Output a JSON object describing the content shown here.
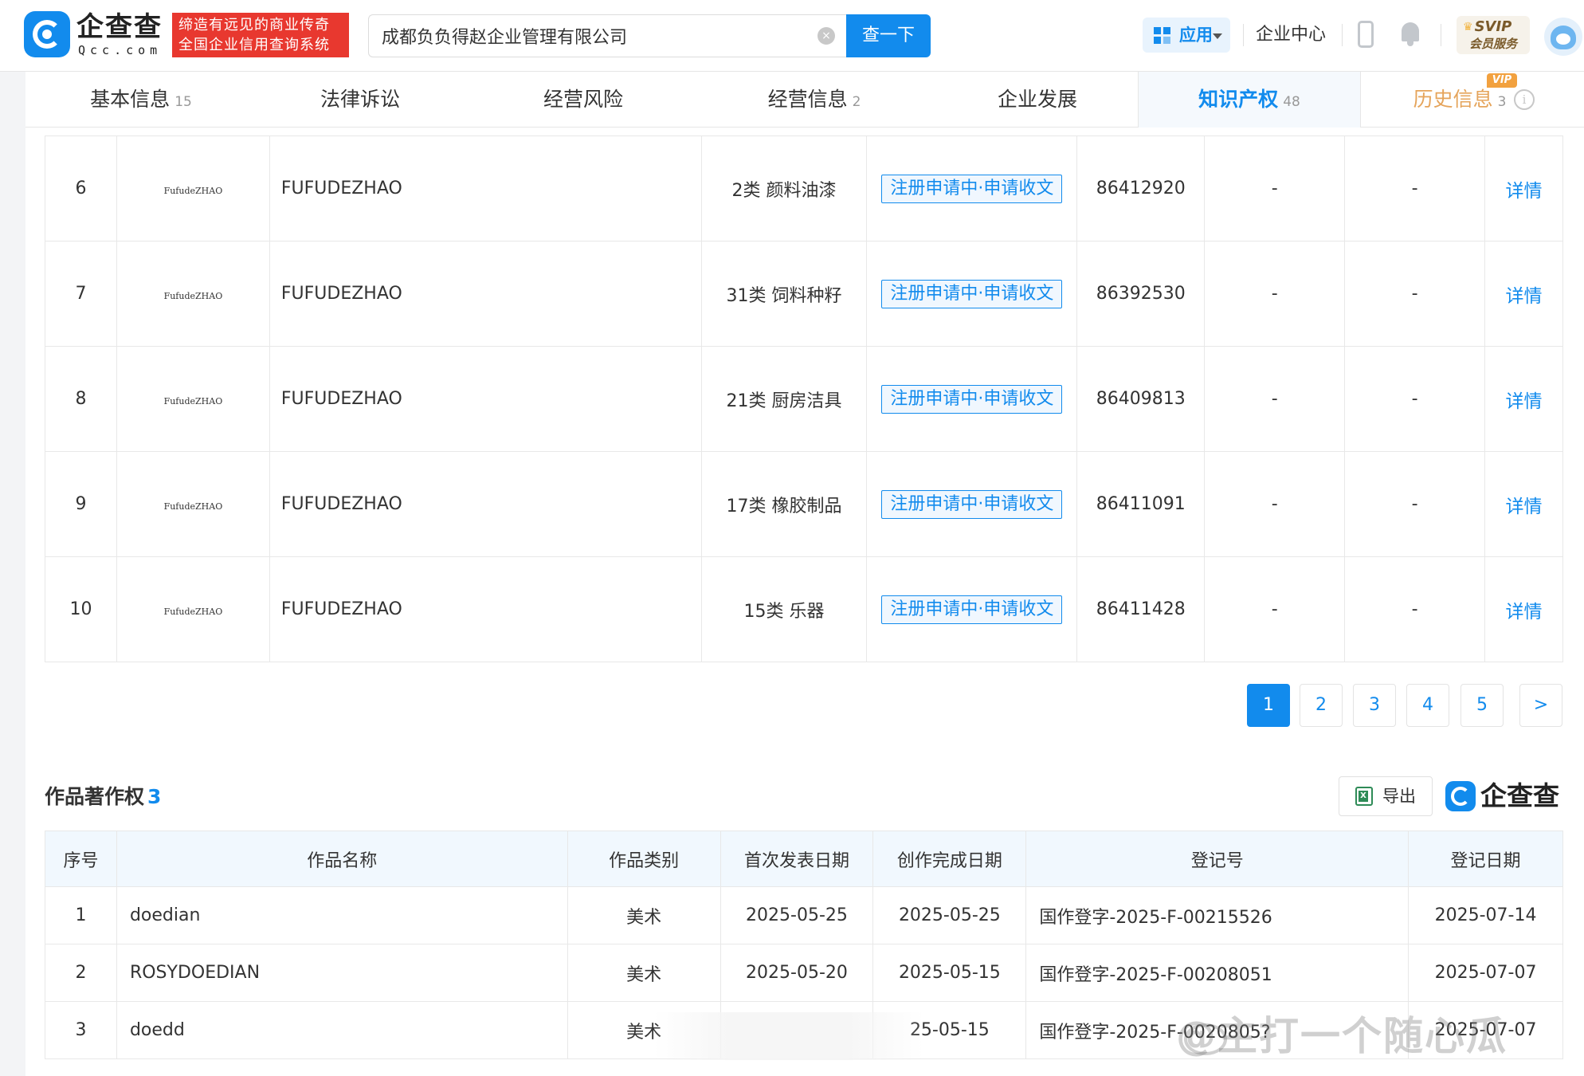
{
  "header": {
    "brand_name": "企查查",
    "brand_sub": "Qcc.com",
    "slogan_line1": "缔造有远见的商业传奇",
    "slogan_line2": "全国企业信用查询系统",
    "search_value": "成都负负得赵企业管理有限公司",
    "search_button": "查一下",
    "apps_label": "应用",
    "enterprise_center": "企业中心",
    "svip_line1": "SVIP",
    "svip_line2": "会员服务"
  },
  "tabs": [
    {
      "label": "基本信息",
      "count": "15"
    },
    {
      "label": "法律诉讼",
      "count": ""
    },
    {
      "label": "经营风险",
      "count": ""
    },
    {
      "label": "经营信息",
      "count": "2"
    },
    {
      "label": "企业发展",
      "count": ""
    },
    {
      "label": "知识产权",
      "count": "48"
    },
    {
      "label": "历史信息",
      "count": "3"
    }
  ],
  "vip_tag": "VIP",
  "trademarks": [
    {
      "no": "6",
      "logo_text": "FufudeZHAO",
      "name": "FUFUDEZHAO",
      "category": "2类 颜料油漆",
      "status": "注册申请中·申请收文",
      "reg_no": "86412920",
      "col7": "-",
      "col8": "-",
      "action": "详情"
    },
    {
      "no": "7",
      "logo_text": "FufudeZHAO",
      "name": "FUFUDEZHAO",
      "category": "31类 饲料种籽",
      "status": "注册申请中·申请收文",
      "reg_no": "86392530",
      "col7": "-",
      "col8": "-",
      "action": "详情"
    },
    {
      "no": "8",
      "logo_text": "FufudeZHAO",
      "name": "FUFUDEZHAO",
      "category": "21类 厨房洁具",
      "status": "注册申请中·申请收文",
      "reg_no": "86409813",
      "col7": "-",
      "col8": "-",
      "action": "详情"
    },
    {
      "no": "9",
      "logo_text": "FufudeZHAO",
      "name": "FUFUDEZHAO",
      "category": "17类 橡胶制品",
      "status": "注册申请中·申请收文",
      "reg_no": "86411091",
      "col7": "-",
      "col8": "-",
      "action": "详情"
    },
    {
      "no": "10",
      "logo_text": "FufudeZHAO",
      "name": "FUFUDEZHAO",
      "category": "15类 乐器",
      "status": "注册申请中·申请收文",
      "reg_no": "86411428",
      "col7": "-",
      "col8": "-",
      "action": "详情"
    }
  ],
  "pagination": {
    "pages": [
      "1",
      "2",
      "3",
      "4",
      "5"
    ],
    "current": "1",
    "next": ">"
  },
  "copyright_section": {
    "title": "作品著作权",
    "count": "3",
    "export_label": "导出",
    "brand": "企查查",
    "headers": [
      "序号",
      "作品名称",
      "作品类别",
      "首次发表日期",
      "创作完成日期",
      "登记号",
      "登记日期"
    ],
    "rows": [
      {
        "no": "1",
        "name": "doedian",
        "type": "美术",
        "first_pub": "2025-05-25",
        "completed": "2025-05-25",
        "reg_no": "国作登字-2025-F-00215526",
        "reg_date": "2025-07-14"
      },
      {
        "no": "2",
        "name": "ROSYDOEDIAN",
        "type": "美术",
        "first_pub": "2025-05-20",
        "completed": "2025-05-15",
        "reg_no": "国作登字-2025-F-00208051",
        "reg_date": "2025-07-07"
      },
      {
        "no": "3",
        "name": "doedd",
        "type": "美术",
        "first_pub": "",
        "completed": "25-05-15",
        "reg_no": "国作登字-2025-F-0020805?",
        "reg_date": "2025-07-07"
      }
    ]
  },
  "watermark": "@主打一个随心瓜"
}
